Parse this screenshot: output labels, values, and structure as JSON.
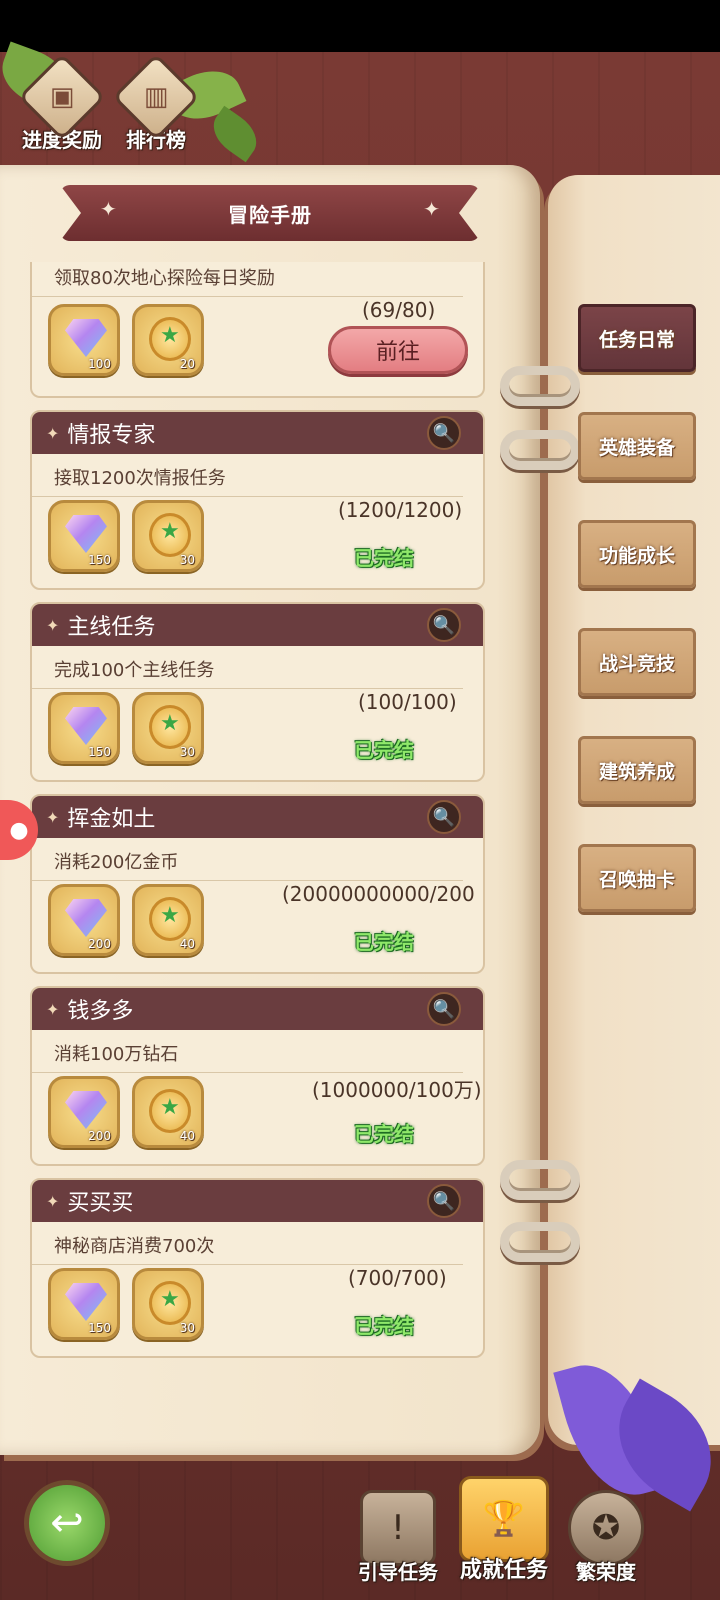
{
  "top_buttons": [
    {
      "label": "进度奖励",
      "icon": "chest-icon"
    },
    {
      "label": "排行榜",
      "icon": "podium-icon"
    }
  ],
  "title": "冒险手册",
  "first_card": {
    "desc": "领取80次地心探险每日奖励",
    "progress": "(69/80)",
    "button": "前往",
    "rewards": [
      {
        "type": "gem",
        "qty": "100"
      },
      {
        "type": "medal",
        "qty": "20"
      }
    ]
  },
  "cards": [
    {
      "name": "情报专家",
      "desc": "接取1200次情报任务",
      "progress": "(1200/1200)",
      "status": "已完结",
      "rewards": [
        {
          "qty": "150"
        },
        {
          "qty": "30"
        }
      ]
    },
    {
      "name": "主线任务",
      "desc": "完成100个主线任务",
      "progress": "(100/100)",
      "status": "已完结",
      "rewards": [
        {
          "qty": "150"
        },
        {
          "qty": "30"
        }
      ]
    },
    {
      "name": "挥金如土",
      "desc": "消耗200亿金币",
      "progress": "(20000000000/200",
      "status": "已完结",
      "rewards": [
        {
          "qty": "200"
        },
        {
          "qty": "40"
        }
      ]
    },
    {
      "name": "钱多多",
      "desc": "消耗100万钻石",
      "progress": "(1000000/100万)",
      "status": "已完结",
      "rewards": [
        {
          "qty": "200"
        },
        {
          "qty": "40"
        }
      ]
    },
    {
      "name": "买买买",
      "desc": "神秘商店消费700次",
      "progress": "(700/700)",
      "status": "已完结",
      "rewards": [
        {
          "qty": "150"
        },
        {
          "qty": "30"
        }
      ]
    }
  ],
  "side_tabs": [
    {
      "label": "任务日常",
      "active": true
    },
    {
      "label": "英雄装备",
      "active": false
    },
    {
      "label": "功能成长",
      "active": false
    },
    {
      "label": "战斗竞技",
      "active": false
    },
    {
      "label": "建筑养成",
      "active": false
    },
    {
      "label": "召唤抽卡",
      "active": false
    }
  ],
  "bottom_tabs": [
    {
      "label": "引导任务",
      "icon": "exclamation-icon"
    },
    {
      "label": "成就任务",
      "icon": "trophy-icon",
      "active": true
    },
    {
      "label": "繁荣度",
      "icon": "laurel-icon"
    }
  ]
}
